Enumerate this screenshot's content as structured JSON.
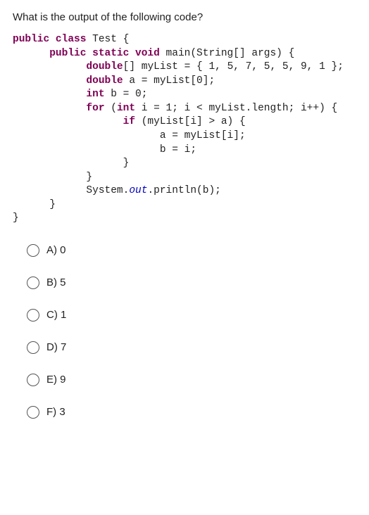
{
  "question": "What is the output of the following code?",
  "code": {
    "l1": {
      "a": "public class",
      "b": " Test {"
    },
    "l2": {
      "a": "      public static void",
      "b": " main(String[] args) {"
    },
    "l3": {
      "a": "            double",
      "b": "[] myList = { 1, 5, 7, 5, 5, 9, 1 };"
    },
    "l4": {
      "a": "            double",
      "b": " a = myList[0];"
    },
    "l5": {
      "a": "            int",
      "b": " b = 0;"
    },
    "l6": {
      "a": "            for",
      "b": " (",
      "c": "int",
      "d": " i = 1; i < myList.length; i++) {"
    },
    "l7": {
      "a": "                  if",
      "b": " (myList[i] > a) {"
    },
    "l8": "                        a = myList[i];",
    "l9": "                        b = i;",
    "l10": "                  }",
    "l11": "            }",
    "l12a": "            System.",
    "l12b": "out",
    "l12c": ".println(b);",
    "l13": "      }",
    "l14": "}"
  },
  "options": [
    {
      "label": "A) 0"
    },
    {
      "label": "B) 5"
    },
    {
      "label": "C) 1"
    },
    {
      "label": "D) 7"
    },
    {
      "label": "E) 9"
    },
    {
      "label": "F) 3"
    }
  ]
}
